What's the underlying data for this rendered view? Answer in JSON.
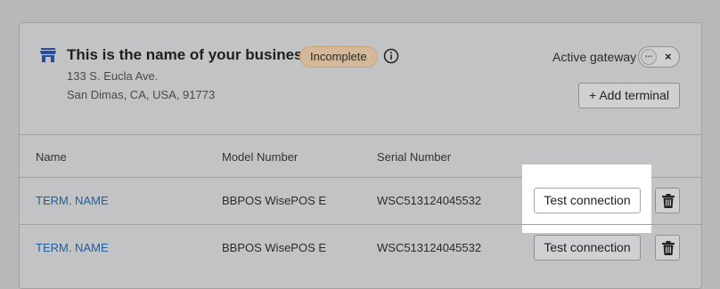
{
  "business": {
    "name": "This is the name of your business",
    "status_badge": "Incomplete",
    "address_line1": "133 S. Eucla Ave.",
    "address_line2": "San Dimas, CA, USA, 91773"
  },
  "gateway": {
    "label": "Active gateway",
    "toggle_on": false,
    "toggle_off_glyph": "×"
  },
  "actions": {
    "add_terminal_label": "+ Add terminal"
  },
  "table": {
    "headers": {
      "name": "Name",
      "model": "Model Number",
      "serial": "Serial Number"
    },
    "rows": [
      {
        "name": "TERM. NAME",
        "model": "BBPOS WisePOS E",
        "serial": "WSC513124045532",
        "test_label": "Test connection"
      },
      {
        "name": "TERM. NAME",
        "model": "BBPOS WisePOS E",
        "serial": "WSC513124045532",
        "test_label": "Test connection"
      }
    ]
  },
  "icons": {
    "store": "store-icon",
    "info": "info-icon",
    "trash": "trash-icon"
  },
  "colors": {
    "link": "#1f5fa3",
    "badge_bg": "#d3b99a",
    "store_icon": "#2b4c9b"
  }
}
